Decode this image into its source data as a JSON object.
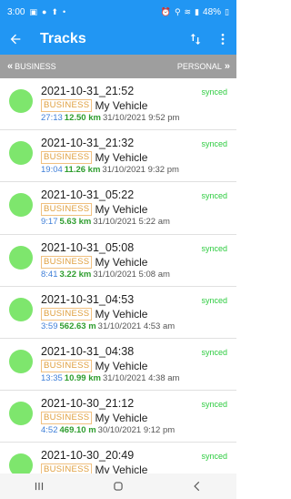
{
  "status": {
    "time": "3:00",
    "battery": "48%"
  },
  "appbar": {
    "title": "Tracks"
  },
  "filter": {
    "left": "BUSINESS",
    "right": "PERSONAL"
  },
  "tracks": [
    {
      "name": "2021-10-31_21:52",
      "tag": "BUSINESS",
      "vehicle": "My Vehicle",
      "duration": "27:13",
      "distance": "12.50 km",
      "when": "31/10/2021 9:52 pm",
      "status": "synced"
    },
    {
      "name": "2021-10-31_21:32",
      "tag": "BUSINESS",
      "vehicle": "My Vehicle",
      "duration": "19:04",
      "distance": "11.26 km",
      "when": "31/10/2021 9:32 pm",
      "status": "synced"
    },
    {
      "name": "2021-10-31_05:22",
      "tag": "BUSINESS",
      "vehicle": "My Vehicle",
      "duration": "9:17",
      "distance": "5.63 km",
      "when": "31/10/2021 5:22 am",
      "status": "synced"
    },
    {
      "name": "2021-10-31_05:08",
      "tag": "BUSINESS",
      "vehicle": "My Vehicle",
      "duration": "8:41",
      "distance": "3.22 km",
      "when": "31/10/2021 5:08 am",
      "status": "synced"
    },
    {
      "name": "2021-10-31_04:53",
      "tag": "BUSINESS",
      "vehicle": "My Vehicle",
      "duration": "3:59",
      "distance": "562.63 m",
      "when": "31/10/2021 4:53 am",
      "status": "synced"
    },
    {
      "name": "2021-10-31_04:38",
      "tag": "BUSINESS",
      "vehicle": "My Vehicle",
      "duration": "13:35",
      "distance": "10.99 km",
      "when": "31/10/2021 4:38 am",
      "status": "synced"
    },
    {
      "name": "2021-10-30_21:12",
      "tag": "BUSINESS",
      "vehicle": "My Vehicle",
      "duration": "4:52",
      "distance": "469.10 m",
      "when": "30/10/2021 9:12 pm",
      "status": "synced"
    },
    {
      "name": "2021-10-30_20:49",
      "tag": "BUSINESS",
      "vehicle": "My Vehicle",
      "duration": "",
      "distance": "",
      "when": "",
      "status": "synced"
    }
  ],
  "colors": {
    "primary": "#2196f3",
    "filter_bg": "#9e9e9e",
    "dot": "#7ee66d",
    "synced": "#2ecc40",
    "duration": "#3f7fd8",
    "distance": "#2e9d2e",
    "tag_border": "#f0c080"
  },
  "icons": {
    "back": "arrow-left-icon",
    "sort": "sort-icon",
    "menu": "more-vert-icon"
  }
}
